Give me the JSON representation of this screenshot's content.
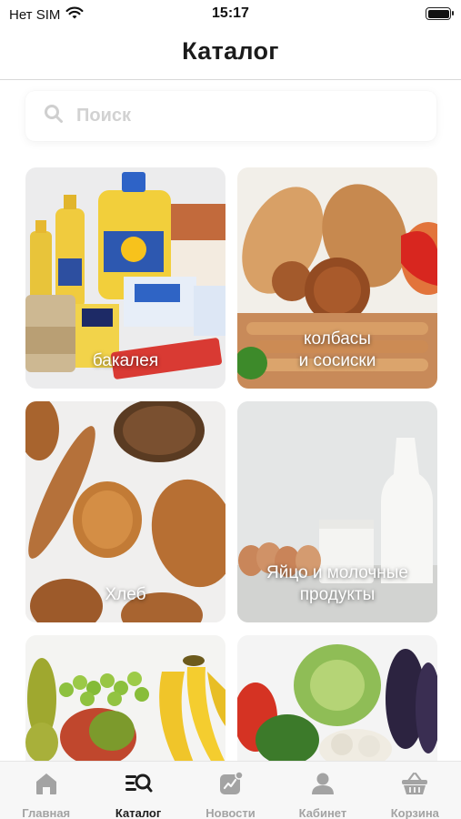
{
  "status_bar": {
    "carrier": "Нет SIM",
    "time": "15:17",
    "wifi_icon": "wifi-icon",
    "battery_icon": "battery-icon"
  },
  "header": {
    "title": "Каталог"
  },
  "search": {
    "placeholder": "Поиск",
    "icon": "search-icon"
  },
  "categories": [
    {
      "line1": "бакалея",
      "line2": ""
    },
    {
      "line1": "колбасы",
      "line2": "и сосиски"
    },
    {
      "line1": "Хлеб",
      "line2": ""
    },
    {
      "line1": "Яйцо и молочные",
      "line2": "продукты"
    },
    {
      "line1": "",
      "line2": ""
    },
    {
      "line1": "",
      "line2": ""
    }
  ],
  "tabbar": {
    "items": [
      {
        "label": "Главная",
        "icon": "home-icon",
        "active": false
      },
      {
        "label": "Каталог",
        "icon": "catalog-search-icon",
        "active": true
      },
      {
        "label": "Новости",
        "icon": "news-icon",
        "active": false
      },
      {
        "label": "Кабинет",
        "icon": "user-icon",
        "active": false
      },
      {
        "label": "Корзина",
        "icon": "basket-icon",
        "active": false
      }
    ]
  },
  "colors": {
    "active_tab": "#1d1d1d",
    "inactive_tab": "#a3a3a3",
    "placeholder": "#d2d2d2"
  }
}
